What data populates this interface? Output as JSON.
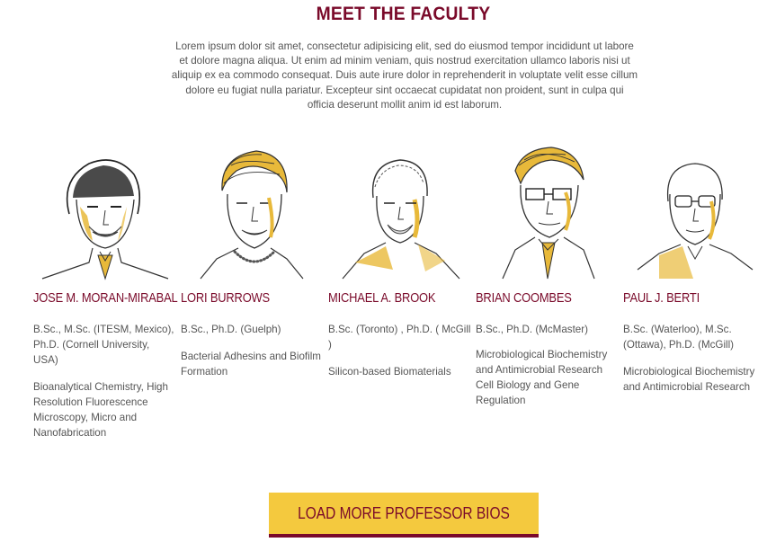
{
  "section": {
    "title": "MEET THE FACULTY",
    "intro": "Lorem ipsum dolor sit amet, consectetur adipisicing elit, sed do eiusmod tempor incididunt ut labore et dolore magna aliqua. Ut enim ad minim veniam, quis nostrud exercitation ullamco laboris nisi ut aliquip ex ea commodo consequat. Duis aute irure dolor in reprehenderit in voluptate velit esse cillum dolore eu fugiat nulla pariatur. Excepteur sint occaecat cupidatat non proident, sunt in culpa qui officia deserunt mollit anim id est laborum."
  },
  "faculty": [
    {
      "name": "JOSE M. MORAN-MIRABAL",
      "degrees": "B.Sc., M.Sc. (ITESM, Mexico), Ph.D. (Cornell University, USA)",
      "research": "Bioanalytical Chemistry, High Resolution Fluorescence Microscopy, Micro and Nanofabrication"
    },
    {
      "name": "LORI BURROWS",
      "degrees": "B.Sc., Ph.D. (Guelph)",
      "research": "Bacterial Adhesins and Biofilm Formation"
    },
    {
      "name": "MICHAEL A. BROOK",
      "degrees": "B.Sc. (Toronto) , Ph.D. ( McGill )",
      "research": "Silicon-based Biomaterials"
    },
    {
      "name": "BRIAN COOMBES",
      "degrees": "B.Sc., Ph.D. (McMaster)",
      "research": "Microbiological Biochemistry and Antimicrobial Research Cell Biology and Gene Regulation"
    },
    {
      "name": "PAUL J. BERTI",
      "degrees": "B.Sc. (Waterloo), M.Sc. (Ottawa), Ph.D. (McGill)",
      "research": "Microbiological Biochemistry and Antimicrobial Research"
    }
  ],
  "load_more": {
    "label": "LOAD MORE PROFESSOR BIOS"
  },
  "colors": {
    "accent": "#7a0a2a",
    "button": "#f4c93e",
    "sketch_highlight": "#e8b93a",
    "text": "#555555"
  }
}
